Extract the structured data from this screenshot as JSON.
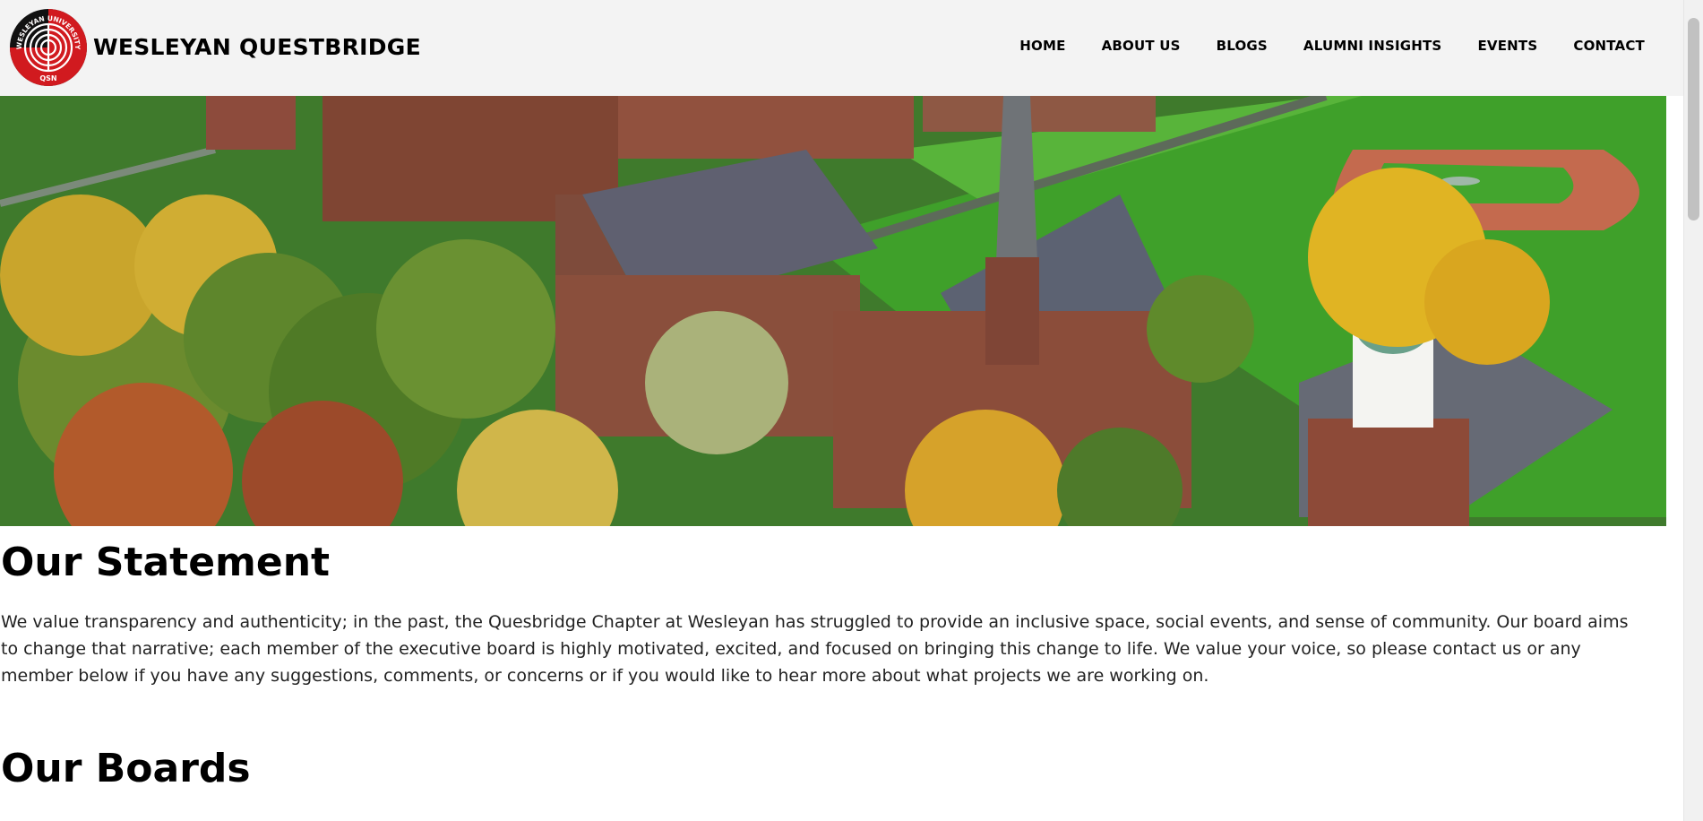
{
  "brand": {
    "name": "WESLEYAN QUESTBRIDGE",
    "logo_top_text": "WESLEYAN UNIVERSITY",
    "logo_bottom_text": "QSN",
    "logo_colors": {
      "red": "#d11a1f",
      "black": "#111111",
      "white": "#ffffff"
    }
  },
  "nav": {
    "items": [
      {
        "label": "HOME"
      },
      {
        "label": "ABOUT US"
      },
      {
        "label": "BLOGS"
      },
      {
        "label": "ALUMNI INSIGHTS"
      },
      {
        "label": "EVENTS"
      },
      {
        "label": "CONTACT"
      }
    ]
  },
  "hero": {
    "content": "aerial-campus-photo"
  },
  "statement": {
    "title": "Our Statement",
    "body": "We value transparency and authenticity; in the past, the Quesbridge Chapter at Wesleyan has struggled to provide an inclusive space, social events, and sense of community. Our board aims to change that narrative; each member of the executive board is highly motivated, excited, and focused on bringing this change to life. We value your voice, so please contact us or any member below if you have any suggestions, comments, or concerns or if you would like to hear more about what projects we are working on."
  },
  "boards": {
    "title": "Our Boards"
  }
}
